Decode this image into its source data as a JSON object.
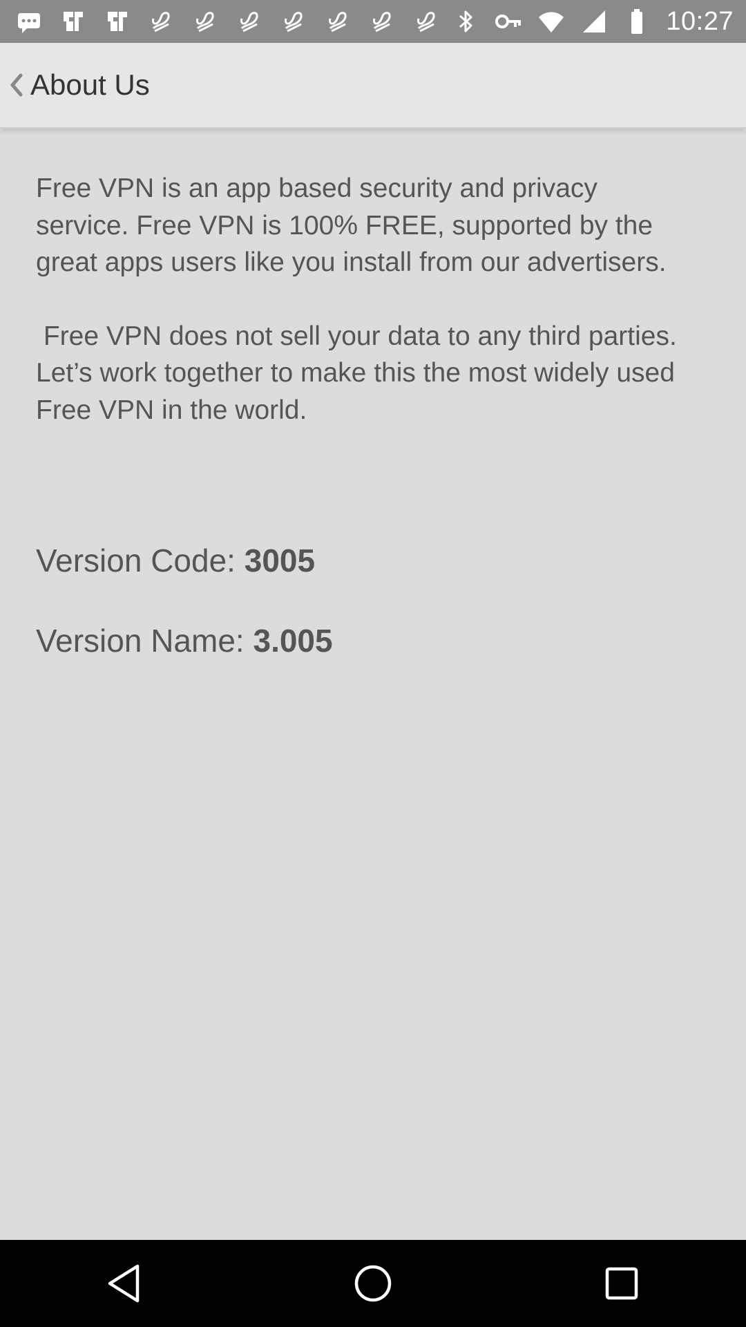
{
  "status_bar": {
    "time": "10:27",
    "left_icons": [
      "messages-icon",
      "fire-icon",
      "fire-icon",
      "notification-icon",
      "notification-icon",
      "notification-icon",
      "notification-icon",
      "notification-icon",
      "notification-icon",
      "notification-icon"
    ],
    "right_icons": [
      "bluetooth-icon",
      "vpn-key-icon",
      "wifi-icon",
      "signal-icon",
      "battery-icon"
    ]
  },
  "app_bar": {
    "title": "About Us"
  },
  "about": {
    "paragraph1": "Free VPN is an app based security and privacy service. Free VPN is 100% FREE, supported by the great apps users like you install from our advertisers.",
    "paragraph2": " Free VPN does not sell your data to any third parties. Let’s work together to make this the most widely used Free VPN in the world."
  },
  "version": {
    "code_label": "Version Code: ",
    "code_value": "3005",
    "name_label": "Version Name: ",
    "name_value": "3.005"
  },
  "colors": {
    "status_bar": "#8a8a8a",
    "app_bar": "#e6e6e6",
    "background": "#dcdcdc",
    "text": "#555555",
    "nav_bar": "#000000"
  }
}
